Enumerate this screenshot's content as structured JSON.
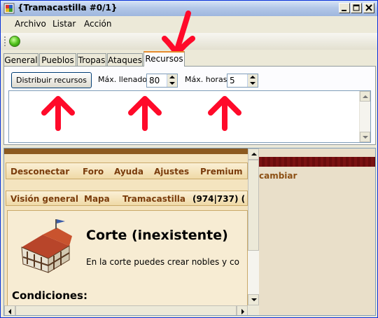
{
  "window": {
    "title": "{Tramacastilla #0/1}"
  },
  "menu": {
    "archivo": "Archivo",
    "listar": "Listar",
    "accion": "Acción"
  },
  "tabs": [
    {
      "label": "General"
    },
    {
      "label": "Pueblos"
    },
    {
      "label": "Tropas"
    },
    {
      "label": "Ataques"
    },
    {
      "label": "Recursos"
    }
  ],
  "recursos": {
    "button_label": "Distribuir recursos",
    "max_llenado_label": "Máx. llenado",
    "max_llenado_value": "80",
    "max_horas_label": "Máx. horas",
    "max_horas_value": "5"
  },
  "browser": {
    "nav": [
      "Desconectar",
      "Foro",
      "Ayuda",
      "Ajustes",
      "Premium"
    ],
    "cambiar": "cambiar",
    "sub": [
      "Visión general",
      "Mapa",
      "Tramacastilla"
    ],
    "coords": "(974|737) (",
    "heading": "Corte (inexistente)",
    "description": "En la corte puedes crear nobles y co",
    "conditions": "Condiciones:"
  },
  "colors": {
    "annotation": "#ff0a2a",
    "status_light": "#52c21c",
    "tab_accent": "#e68b2c"
  }
}
